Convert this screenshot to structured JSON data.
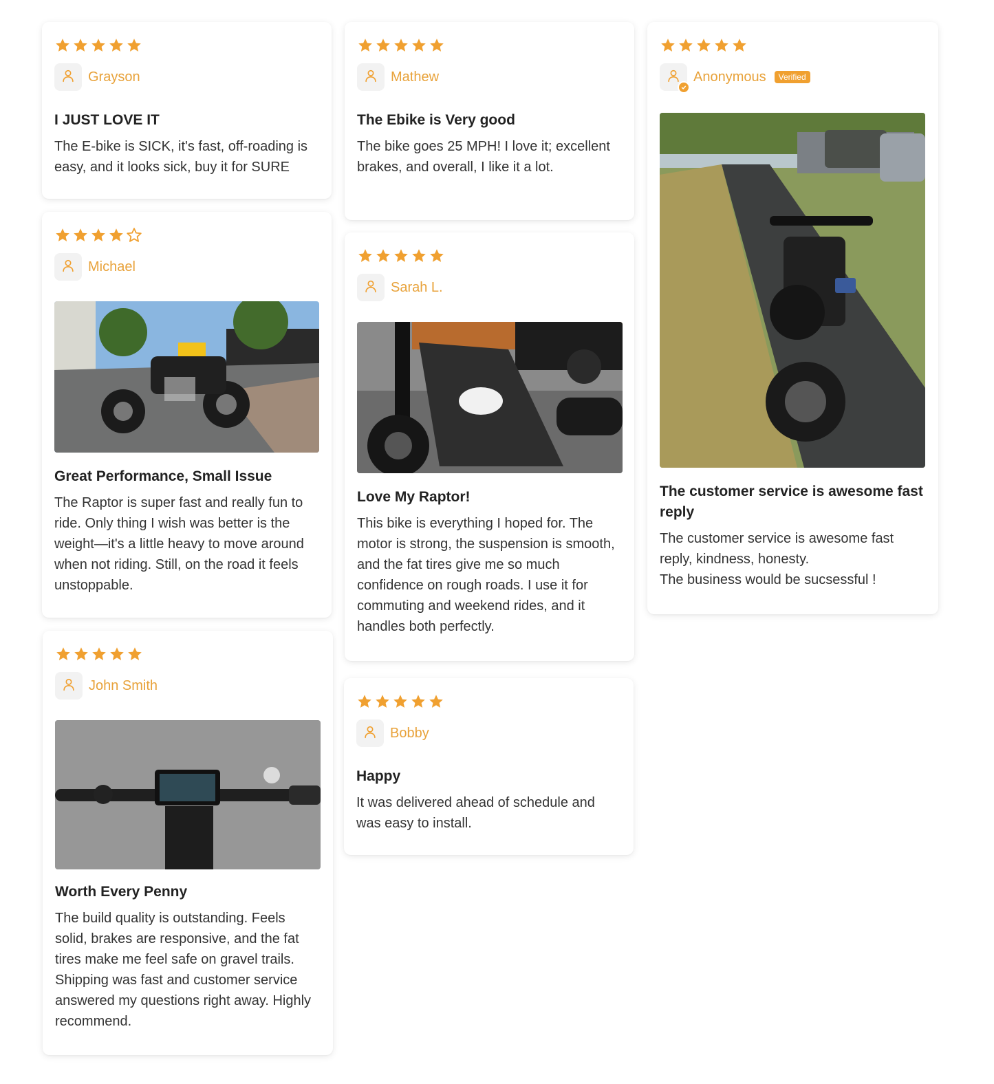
{
  "colors": {
    "accent": "#f0a030",
    "name": "#e8a23a",
    "star_empty_stroke": "#f0a030"
  },
  "reviews": [
    {
      "rating": 5,
      "author": "Grayson",
      "title": "I JUST LOVE IT",
      "body": "The E-bike is SICK, it's fast, off-roading is easy, and it looks sick, buy it for SURE"
    },
    {
      "rating": 5,
      "author": "Mathew",
      "title": "The Ebike is Very good",
      "body": "The bike goes 25 MPH! I love it; excellent brakes, and overall, I like it a lot."
    },
    {
      "rating": 5,
      "author": "Anonymous",
      "verified": "Verified",
      "title": "The customer service is awesome fast reply",
      "body": "The customer service is awesome fast reply, kindness, honesty.\nThe business would be sucsessful !"
    },
    {
      "rating": 4,
      "author": "Michael",
      "title": "Great Performance, Small Issue",
      "body": "The Raptor is super fast and really fun to ride. Only thing I wish was better is the weight—it's a little heavy to move around when not riding. Still, on the road it feels unstoppable."
    },
    {
      "rating": 5,
      "author": "Sarah L.",
      "title": "Love My Raptor!",
      "body": "This bike is everything I hoped for. The motor is strong, the suspension is smooth, and the fat tires give me so much confidence on rough roads. I use it for commuting and weekend rides, and it handles both perfectly."
    },
    {
      "rating": 5,
      "author": "John Smith",
      "title": "Worth Every Penny",
      "body": "The build quality is outstanding. Feels solid, brakes are responsive, and the fat tires make me feel safe on gravel trails. Shipping was fast and customer service answered my questions right away. Highly recommend."
    },
    {
      "rating": 5,
      "author": "Bobby",
      "title": "Happy",
      "body": "It was delivered ahead of schedule and was easy to install."
    }
  ]
}
